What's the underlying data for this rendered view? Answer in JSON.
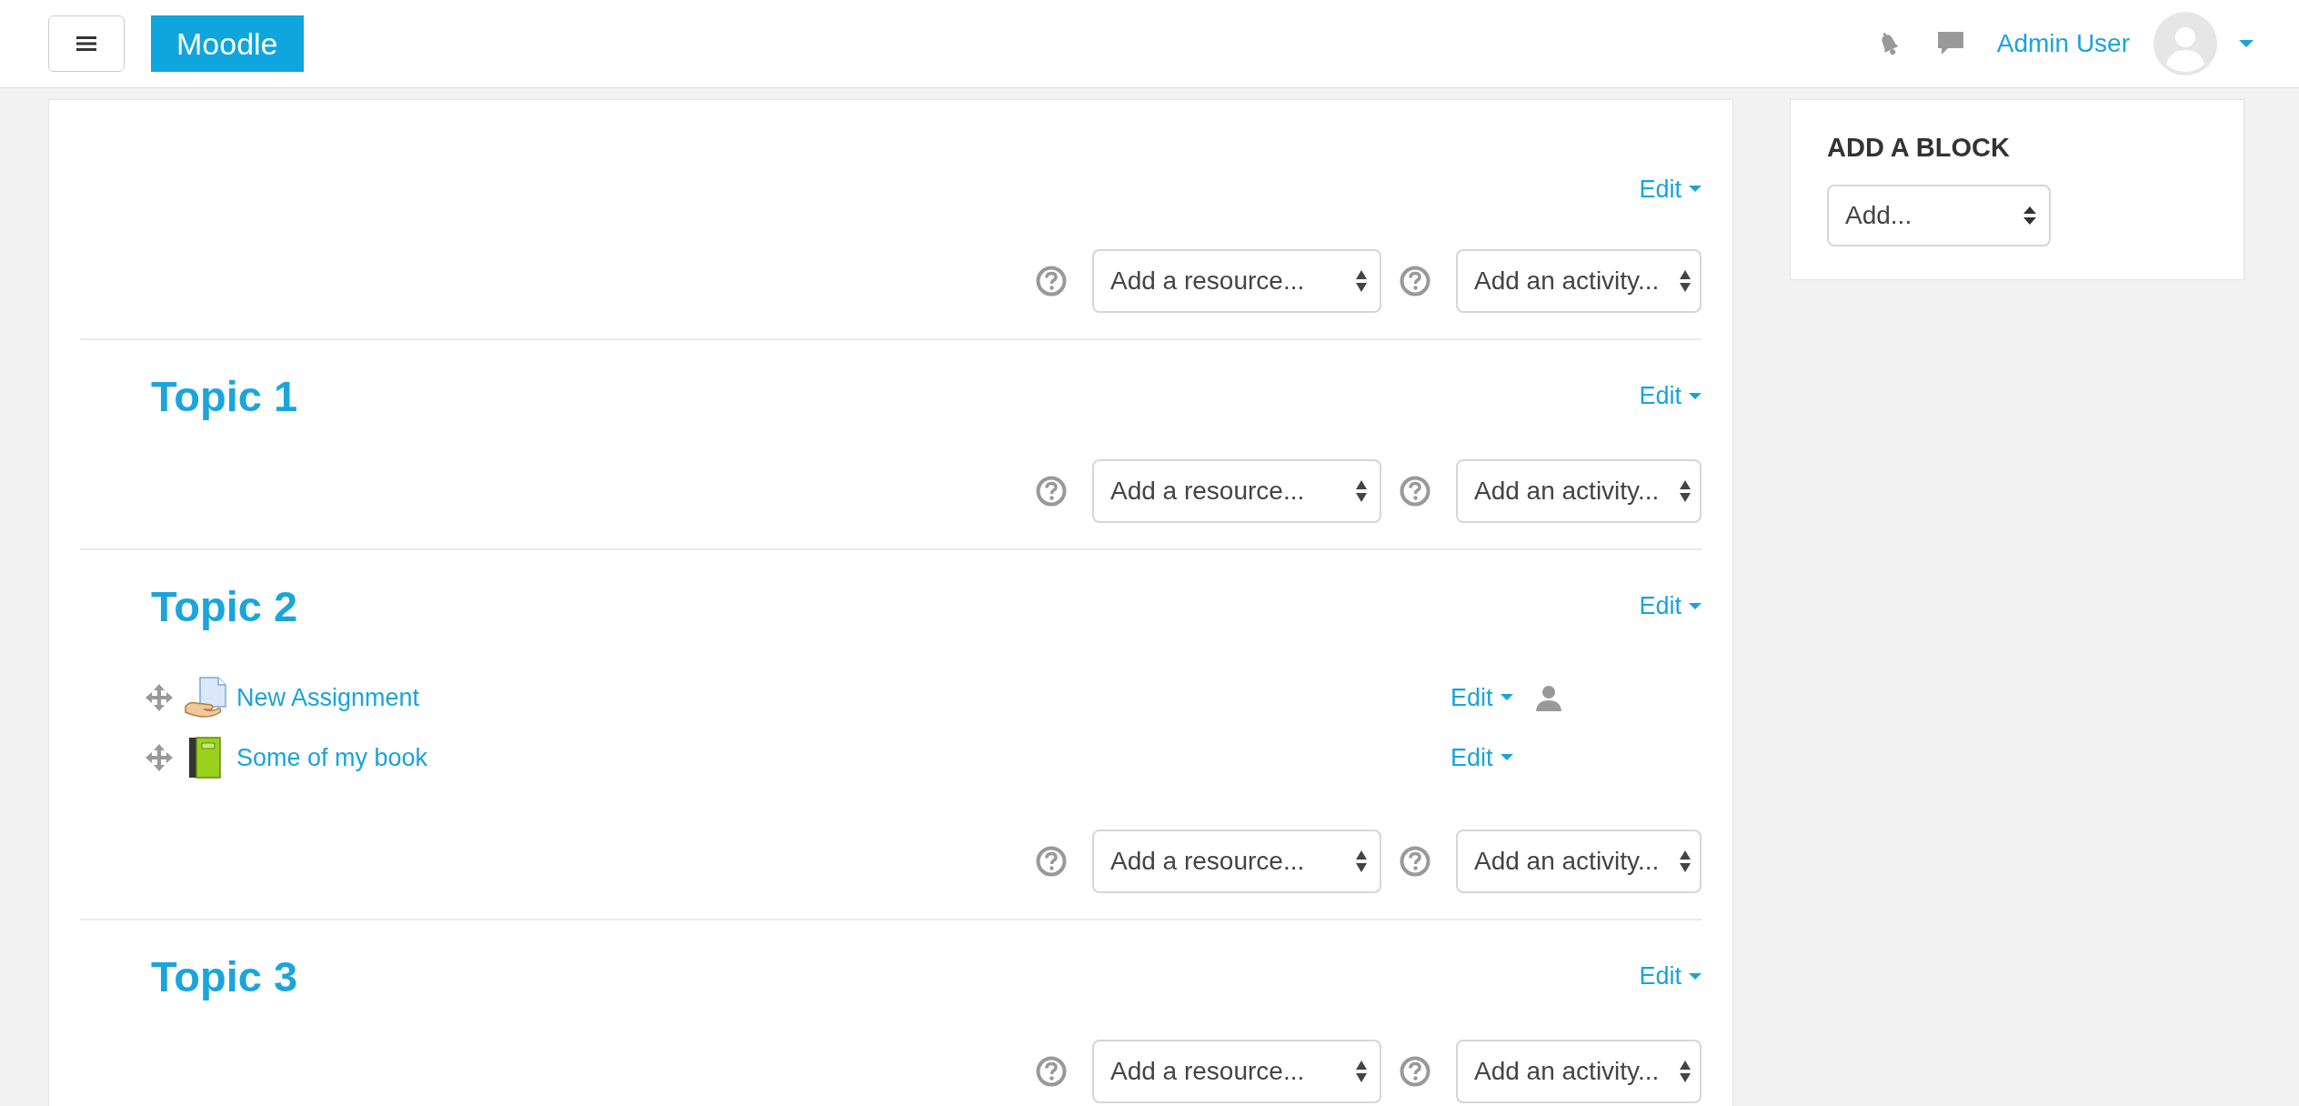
{
  "header": {
    "brand": "Moodle",
    "user_name": "Admin User"
  },
  "sections": [
    {
      "edit": "Edit",
      "add_resource": "Add a resource...",
      "add_activity": "Add an activity..."
    },
    {
      "title": "Topic 1",
      "edit": "Edit",
      "add_resource": "Add a resource...",
      "add_activity": "Add an activity..."
    },
    {
      "title": "Topic 2",
      "edit": "Edit",
      "activities": [
        {
          "kind": "assignment",
          "name": "New Assignment",
          "edit": "Edit",
          "user_icon": true
        },
        {
          "kind": "book",
          "name": "Some of my book",
          "edit": "Edit",
          "user_icon": false
        }
      ],
      "add_resource": "Add a resource...",
      "add_activity": "Add an activity..."
    },
    {
      "title": "Topic 3",
      "edit": "Edit",
      "add_resource": "Add a resource...",
      "add_activity": "Add an activity..."
    }
  ],
  "sidebar": {
    "title": "ADD A BLOCK",
    "select": "Add..."
  }
}
